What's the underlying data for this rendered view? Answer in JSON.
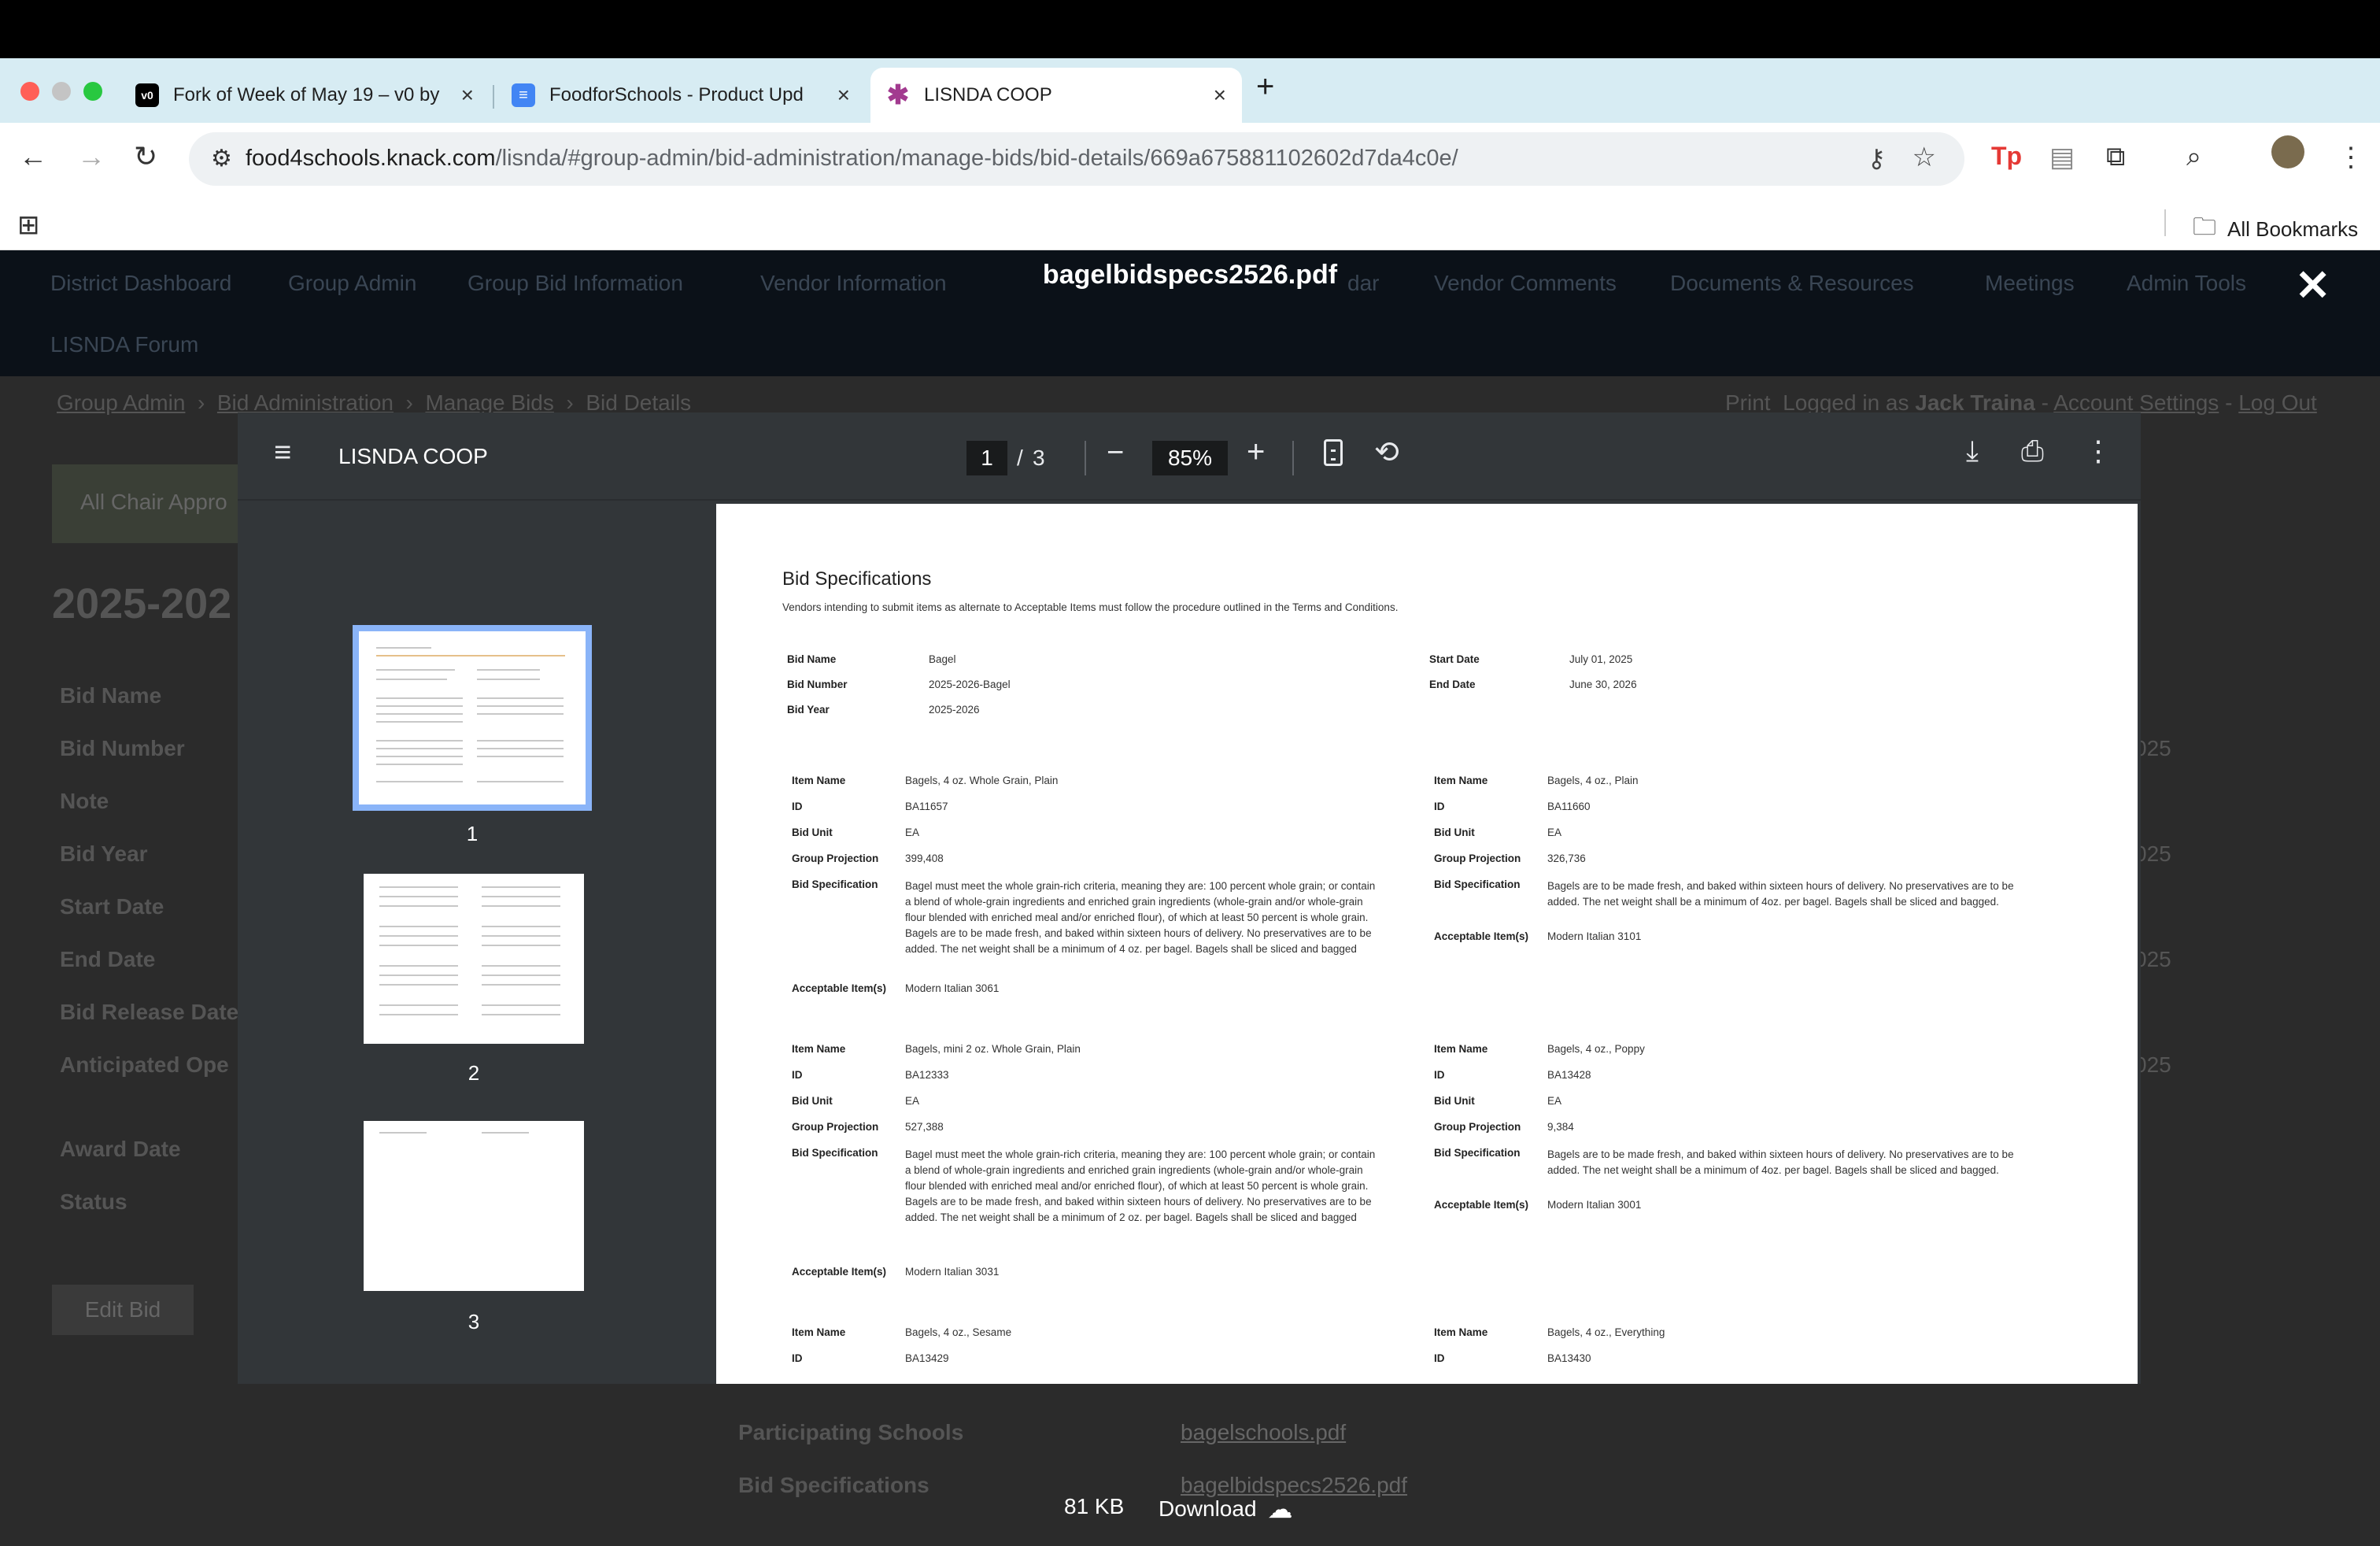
{
  "browser": {
    "tabs": [
      {
        "title": "Fork of Week of May 19 – v0 by",
        "favicon_text": "v0"
      },
      {
        "title": "FoodforSchools - Product Upd",
        "favicon_text": "≡"
      },
      {
        "title": "LISNDA COOP",
        "favicon_text": "✱"
      }
    ],
    "url_host": "food4schools.knack.com",
    "url_path": "/lisnda/#group-admin/bid-administration/manage-bids/bid-details/669a675881102602d7da4c0e/",
    "all_bookmarks": "All Bookmarks"
  },
  "site": {
    "nav": [
      "District Dashboard",
      "Group Admin",
      "Group Bid Information",
      "Vendor Information",
      "dar",
      "Vendor Comments",
      "Documents & Resources",
      "Meetings",
      "Admin Tools",
      "LISNDA Forum"
    ],
    "breadcrumbs": [
      "Group Admin",
      "Bid Administration",
      "Manage Bids",
      "Bid Details"
    ],
    "print": "Print",
    "logged_in_prefix": "Logged in as",
    "user": "Jack Traina",
    "account_settings": "Account Settings",
    "log_out": "Log Out",
    "chair_approval": "All Chair Appro",
    "page_title": "2025-202",
    "fields": [
      "Bid Name",
      "Bid Number",
      "Note",
      "Bid Year",
      "Start Date",
      "End Date",
      "Bid Release Date",
      "Anticipated Ope",
      "Award Date",
      "Status"
    ],
    "right_values": [
      "025",
      "025",
      "025",
      "025"
    ],
    "edit_bid": "Edit Bid",
    "files": [
      {
        "label": "Participating Schools",
        "file": "bagelschools.pdf"
      },
      {
        "label": "Bid Specifications",
        "file": "bagelbidspecs2526.pdf"
      }
    ]
  },
  "modal": {
    "title": "bagelbidspecs2526.pdf",
    "size": "81 KB",
    "download": "Download"
  },
  "pdf_viewer": {
    "doc_title": "LISNDA COOP",
    "current_page": "1",
    "page_sep": "/",
    "total_pages": "3",
    "zoom": "85%",
    "thumbnails": [
      "1",
      "2",
      "3"
    ]
  },
  "document": {
    "heading": "Bid Specifications",
    "subheading": "Vendors intending to submit items as alternate to Acceptable Items must follow the procedure outlined in the Terms and Conditions.",
    "header_fields": {
      "bid_name_label": "Bid Name",
      "bid_name": "Bagel",
      "bid_number_label": "Bid Number",
      "bid_number": "2025-2026-Bagel",
      "bid_year_label": "Bid Year",
      "bid_year": "2025-2026",
      "start_date_label": "Start Date",
      "start_date": "July 01, 2025",
      "end_date_label": "End Date",
      "end_date": "June 30, 2026"
    },
    "labels": {
      "item_name": "Item Name",
      "id": "ID",
      "bid_unit": "Bid Unit",
      "group_projection": "Group Projection",
      "bid_specification": "Bid Specification",
      "acceptable_items": "Acceptable Item(s)"
    },
    "items": [
      {
        "name": "Bagels, 4 oz. Whole Grain, Plain",
        "id": "BA11657",
        "unit": "EA",
        "projection": "399,408",
        "spec": "Bagel must meet the whole grain-rich criteria, meaning they are:  100 percent whole grain; or contain a blend of whole-grain ingredients and enriched grain ingredients (whole-grain and/or whole-grain flour blended with enriched meal and/or enriched flour), of which at least 50 percent is whole grain. Bagels are to be made fresh, and baked within sixteen hours of delivery. No preservatives are to be added. The net weight shall be a minimum of 4 oz. per bagel. Bagels shall be sliced and bagged",
        "acceptable": "Modern Italian 3061"
      },
      {
        "name": "Bagels, 4 oz., Plain",
        "id": "BA11660",
        "unit": "EA",
        "projection": "326,736",
        "spec": "Bagels are to be made fresh, and baked within sixteen hours of delivery. No preservatives are to be added. The net weight shall be a minimum of 4oz. per bagel. Bagels shall be sliced and bagged.",
        "acceptable": "Modern Italian 3101"
      },
      {
        "name": "Bagels, mini 2 oz. Whole Grain, Plain",
        "id": "BA12333",
        "unit": "EA",
        "projection": "527,388",
        "spec": "Bagel must meet the whole grain-rich criteria, meaning they are:  100 percent whole grain; or contain a blend of whole-grain ingredients and enriched grain ingredients (whole-grain and/or whole-grain flour blended with enriched meal and/or enriched flour), of which at least 50 percent is whole grain. Bagels are to be made fresh, and baked within sixteen hours of delivery. No preservatives are to be added. The net weight shall be a minimum of 2 oz. per bagel. Bagels shall be sliced and bagged",
        "acceptable": "Modern Italian 3031"
      },
      {
        "name": "Bagels, 4 oz., Poppy",
        "id": "BA13428",
        "unit": "EA",
        "projection": "9,384",
        "spec": "Bagels are to be made fresh, and baked within sixteen hours of delivery. No preservatives are to be added. The net weight shall be a minimum of 4oz. per bagel. Bagels shall be sliced and bagged.",
        "acceptable": "Modern Italian 3001"
      },
      {
        "name": "Bagels, 4 oz., Sesame",
        "id": "BA13429"
      },
      {
        "name": "Bagels, 4 oz., Everything",
        "id": "BA13430"
      }
    ]
  }
}
